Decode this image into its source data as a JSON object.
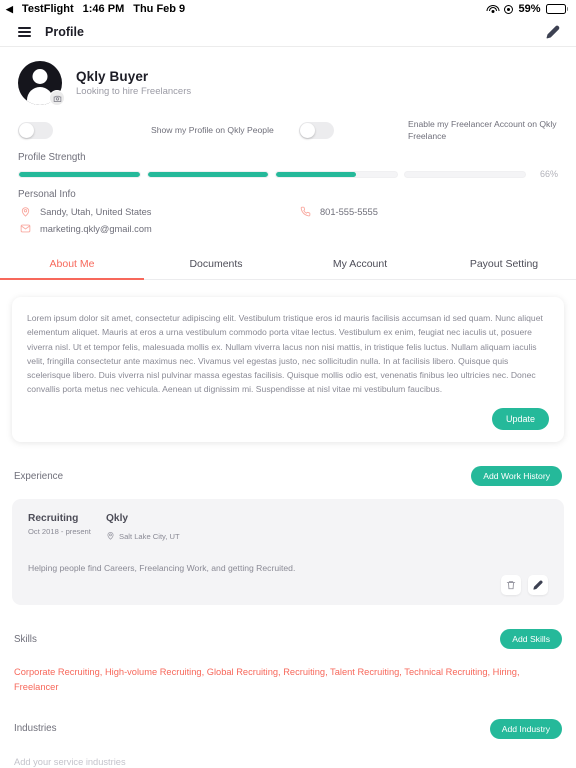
{
  "statusbar": {
    "back_glyph": "◀",
    "carrier": "TestFlight",
    "time": "1:46 PM",
    "date": "Thu Feb 9",
    "wifi_icon": "wifi-icon",
    "location_icon": "location-services-icon",
    "battery_percent": "59%",
    "battery_level": 59
  },
  "appbar": {
    "menu_icon": "hamburger-menu-icon",
    "title": "Profile",
    "edit_icon": "pencil-icon"
  },
  "profile": {
    "avatar_icon": "default-avatar-icon",
    "camera_badge_icon": "camera-icon",
    "name": "Qkly Buyer",
    "tagline": "Looking to hire Freelancers"
  },
  "toggles": [
    {
      "label": "Show my Profile on Qkly People",
      "on": false
    },
    {
      "label": "Enable my Freelancer Account on Qkly Freelance",
      "on": false
    }
  ],
  "strength": {
    "title": "Profile Strength",
    "percent_label": "66%",
    "segments": [
      100,
      100,
      66,
      0
    ],
    "fill_color": "#25b99a"
  },
  "personal_info": {
    "title": "Personal Info",
    "location": {
      "icon": "map-pin-icon",
      "value": "Sandy, Utah, United States"
    },
    "phone": {
      "icon": "phone-icon",
      "value": "801-555-5555"
    },
    "email": {
      "icon": "envelope-icon",
      "value": "marketing.qkly@gmail.com"
    },
    "icon_color": "#f9a9a0"
  },
  "tabs": [
    {
      "label": "About Me",
      "active": true
    },
    {
      "label": "Documents",
      "active": false
    },
    {
      "label": "My Account",
      "active": false
    },
    {
      "label": "Payout Setting",
      "active": false
    }
  ],
  "about": {
    "text": "Lorem ipsum dolor sit amet, consectetur adipiscing elit. Vestibulum tristique eros id mauris facilisis accumsan id sed quam. Nunc aliquet elementum aliquet. Mauris at eros a urna vestibulum commodo porta vitae lectus. Vestibulum ex enim, feugiat nec iaculis ut, posuere viverra nisl. Ut et tempor felis, malesuada mollis ex. Nullam viverra lacus non nisi mattis, in tristique felis luctus. Nullam aliquam iaculis velit, fringilla consectetur ante maximus nec. Vivamus vel egestas justo, nec sollicitudin nulla. In at facilisis libero. Quisque quis scelerisque libero. Duis viverra nisl pulvinar massa egestas facilisis. Quisque mollis odio est, venenatis finibus leo ultricies nec. Donec convallis porta metus nec vehicula. Aenean ut dignissim mi. Suspendisse at nisl vitae mi vestibulum faucibus.",
    "update_label": "Update"
  },
  "experience": {
    "title": "Experience",
    "add_label": "Add Work History",
    "items": [
      {
        "role": "Recruiting",
        "dates": "Oct 2018 - present",
        "company": "Qkly",
        "location_icon": "map-pin-icon",
        "location": "Salt Lake City, UT",
        "description": "Helping people find Careers, Freelancing Work, and getting Recruited.",
        "delete_icon": "trash-icon",
        "edit_icon": "pencil-icon"
      }
    ]
  },
  "skills": {
    "title": "Skills",
    "add_label": "Add Skills",
    "text": "Corporate Recruiting, High-volume Recruiting, Global Recruiting, Recruiting, Talent Recruiting, Technical Recruiting, Hiring, Freelancer",
    "color": "#f7685b"
  },
  "industries": {
    "title": "Industries",
    "add_label": "Add Industry",
    "placeholder": "Add your service industries"
  },
  "theme": {
    "accent_green": "#25b99a",
    "accent_red": "#f7685b",
    "text_dark": "#1d1d26",
    "text_muted": "#8a8a95"
  }
}
